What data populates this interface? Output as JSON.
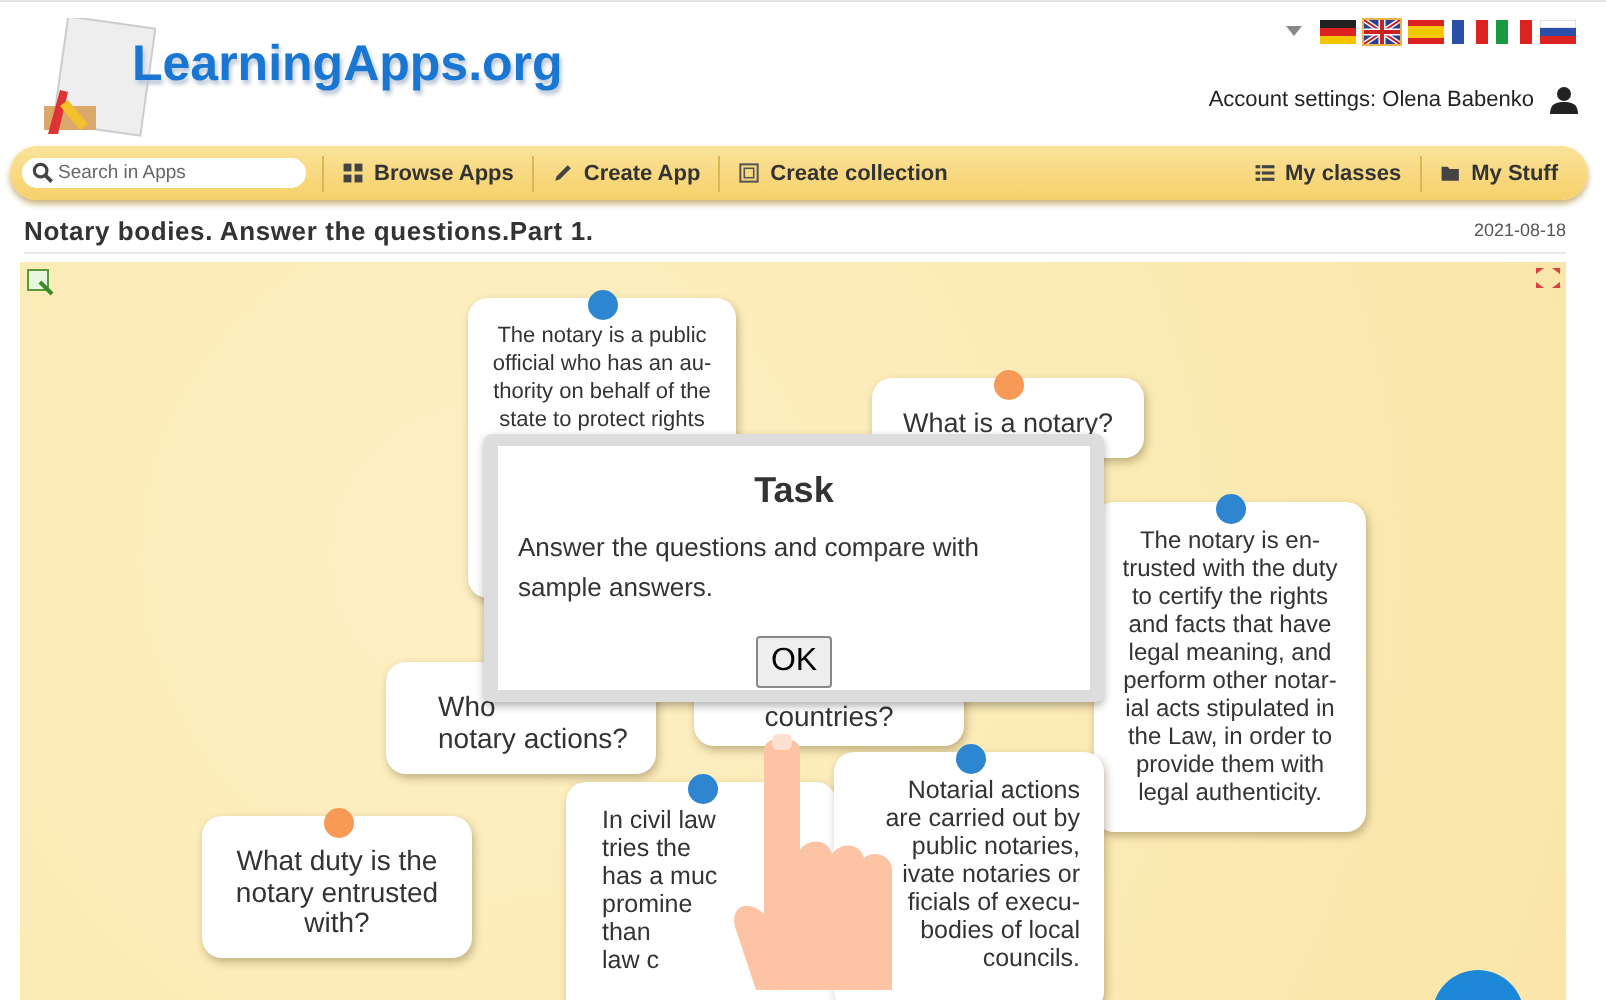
{
  "logo": {
    "text": "LearningApps.org"
  },
  "languages": [
    {
      "kind": "de",
      "selected": false
    },
    {
      "kind": "gb",
      "selected": true
    },
    {
      "kind": "es",
      "selected": false
    },
    {
      "kind": "fr",
      "selected": false
    },
    {
      "kind": "it",
      "selected": false
    },
    {
      "kind": "ru",
      "selected": false
    }
  ],
  "account": {
    "text": "Account settings: Olena Babenko"
  },
  "nav": {
    "search": {
      "placeholder": "Search in Apps"
    },
    "left": [
      {
        "label": "Browse Apps",
        "kind": "grid"
      },
      {
        "label": "Create App",
        "kind": "pencil"
      },
      {
        "label": "Create collection",
        "kind": "collection"
      }
    ],
    "right": [
      {
        "label": "My classes",
        "kind": "list"
      },
      {
        "label": "My Stuff",
        "kind": "folder"
      }
    ]
  },
  "page": {
    "title": "Notary bodies. Answer the questions.Part 1.",
    "date": "2021-08-18"
  },
  "cards": [
    {
      "kind": "answer",
      "color": "#2f86d0",
      "lines": [
        "The notary is a public",
        "official who has an au-",
        "thority on behalf of the",
        "state to protect rights"
      ]
    },
    {
      "kind": "question",
      "color": "#f79a55",
      "lines": [
        "What is a notary?"
      ]
    },
    {
      "kind": "answer",
      "color": "#2f86d0",
      "lines": [
        "The notary is en-",
        "trusted with the duty",
        "to certify the rights",
        "and facts that have",
        "legal meaning, and",
        "perform other notar-",
        "ial acts stipulated in",
        "the Law, in order to",
        "provide them with",
        "legal authenticity."
      ]
    },
    {
      "kind": "question",
      "lines": [
        "Who",
        "notary actions?"
      ]
    },
    {
      "kind": "question",
      "lines": [
        "countries?"
      ]
    },
    {
      "kind": "question",
      "color": "#f79a55",
      "lines": [
        "What duty is the",
        "notary entrusted",
        "with?"
      ]
    },
    {
      "kind": "answer",
      "color": "#2f86d0",
      "lines": [
        "In civil law",
        "tries the",
        "has a muc",
        "promine",
        "than",
        "law c"
      ]
    },
    {
      "kind": "answer",
      "color": "#2f86d0",
      "lines": [
        "Notarial actions",
        "are carried out by",
        "public notaries,",
        "ivate notaries or",
        "ficials of execu-",
        "bodies of local",
        "councils."
      ]
    }
  ],
  "modal": {
    "title": "Task",
    "text": "Answer the questions and compare with sample answers.",
    "button": "OK"
  }
}
